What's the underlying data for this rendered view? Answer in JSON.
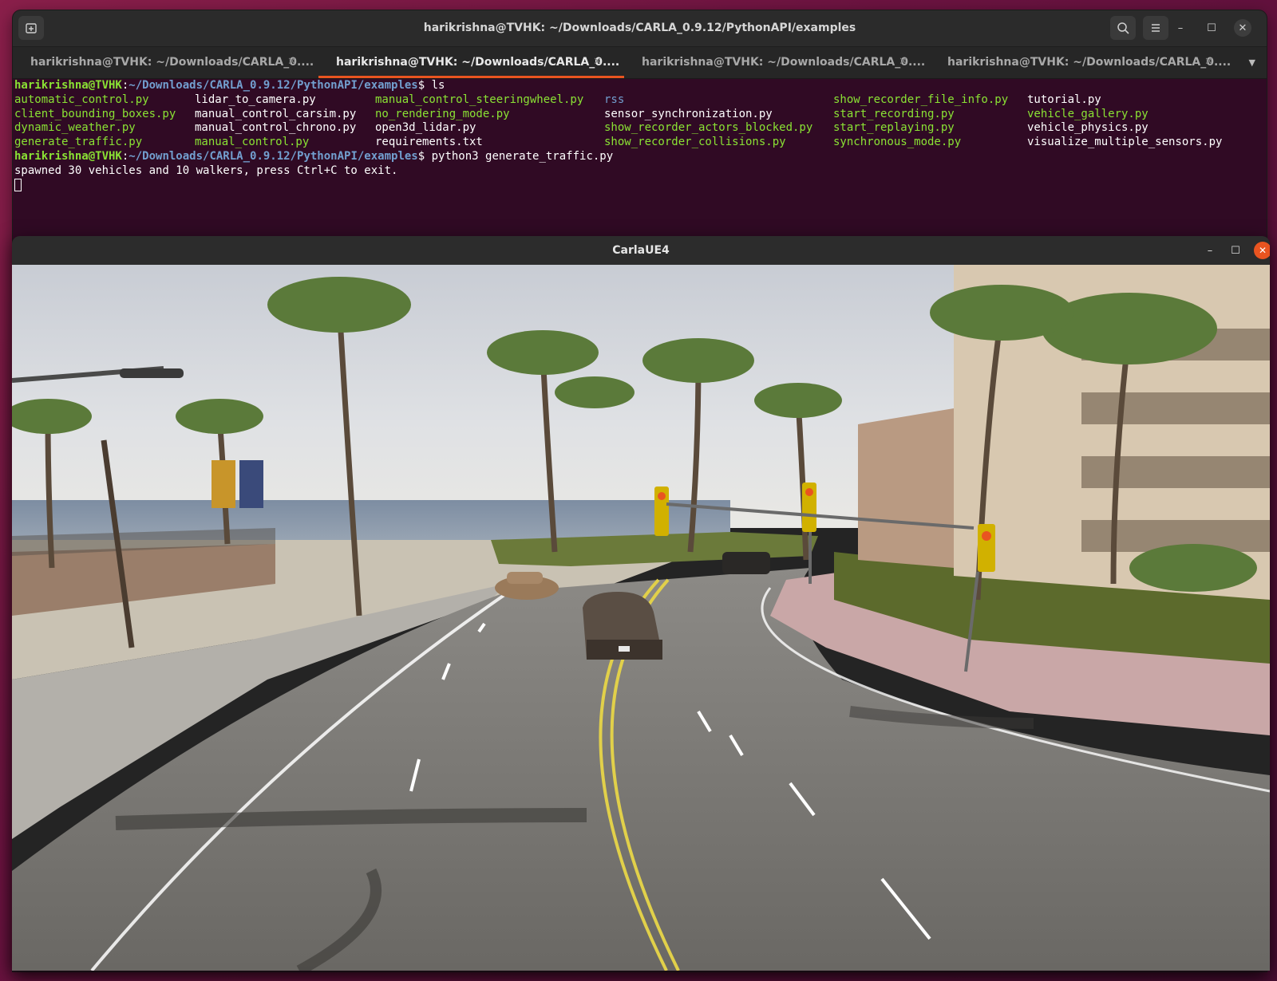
{
  "terminal": {
    "title": "harikrishna@TVHK: ~/Downloads/CARLA_0.9.12/PythonAPI/examples",
    "tabs": [
      {
        "label": "harikrishna@TVHK: ~/Downloads/CARLA_0....",
        "active": false
      },
      {
        "label": "harikrishna@TVHK: ~/Downloads/CARLA_0....",
        "active": true
      },
      {
        "label": "harikrishna@TVHK: ~/Downloads/CARLA_0....",
        "active": false
      },
      {
        "label": "harikrishna@TVHK: ~/Downloads/CARLA_0....",
        "active": false
      }
    ],
    "prompt_user": "harikrishna@TVHK",
    "prompt_path": "~/Downloads/CARLA_0.9.12/PythonAPI/examples",
    "command1": "ls",
    "files": [
      [
        "automatic_control.py",
        "lidar_to_camera.py",
        "manual_control_steeringwheel.py",
        "rss",
        "show_recorder_file_info.py",
        "tutorial.py"
      ],
      [
        "client_bounding_boxes.py",
        "manual_control_carsim.py",
        "no_rendering_mode.py",
        "sensor_synchronization.py",
        "start_recording.py",
        "vehicle_gallery.py"
      ],
      [
        "dynamic_weather.py",
        "manual_control_chrono.py",
        "open3d_lidar.py",
        "show_recorder_actors_blocked.py",
        "start_replaying.py",
        "vehicle_physics.py"
      ],
      [
        "generate_traffic.py",
        "manual_control.py",
        "requirements.txt",
        "show_recorder_collisions.py",
        "synchronous_mode.py",
        "visualize_multiple_sensors.py"
      ]
    ],
    "file_kinds": [
      [
        "exec",
        "plain",
        "exec",
        "dir",
        "exec",
        "plain"
      ],
      [
        "exec",
        "plain",
        "exec",
        "plain",
        "exec",
        "exec"
      ],
      [
        "exec",
        "plain",
        "plain",
        "exec",
        "exec",
        "plain"
      ],
      [
        "exec",
        "exec",
        "plain",
        "exec",
        "exec",
        "plain"
      ]
    ],
    "command2": "python3 generate_traffic.py",
    "output": "spawned 30 vehicles and 10 walkers, press Ctrl+C to exit.",
    "colors": {
      "background": "#300a24",
      "exec": "#8ae234",
      "dir": "#729fcf",
      "accent": "#e95420"
    },
    "icons": {
      "new_tab": "new-tab-icon",
      "search": "search-icon",
      "menu": "hamburger-menu-icon"
    }
  },
  "carla": {
    "title": "CarlaUE4",
    "scene": "3d-city-street-render"
  }
}
